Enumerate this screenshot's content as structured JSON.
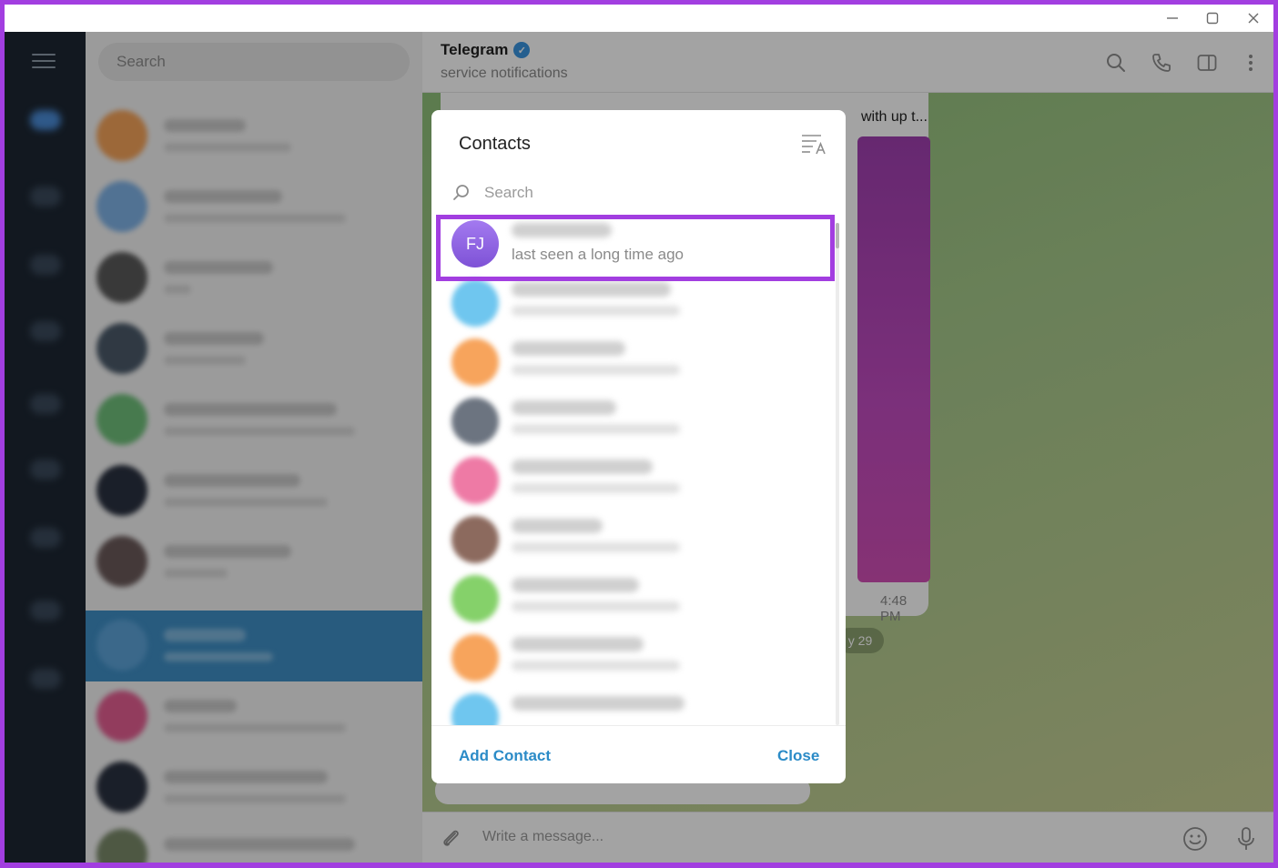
{
  "chat": {
    "title": "Telegram",
    "subtitle": "service notifications",
    "message_snippet": "with up t...",
    "message_time": "4:48 PM",
    "date_pill": "y 29",
    "composer_placeholder": "Write a message..."
  },
  "sidebar": {
    "search_placeholder": "Search"
  },
  "dialog": {
    "title": "Contacts",
    "search_placeholder": "Search",
    "first_contact_initials": "FJ",
    "first_contact_status": "last seen a long time ago",
    "add_contact_label": "Add Contact",
    "close_label": "Close"
  },
  "colors": {
    "accent": "#2b8bc7",
    "highlight_border": "#a23ee0",
    "first_contact_avatar": "#8e5fe0"
  }
}
